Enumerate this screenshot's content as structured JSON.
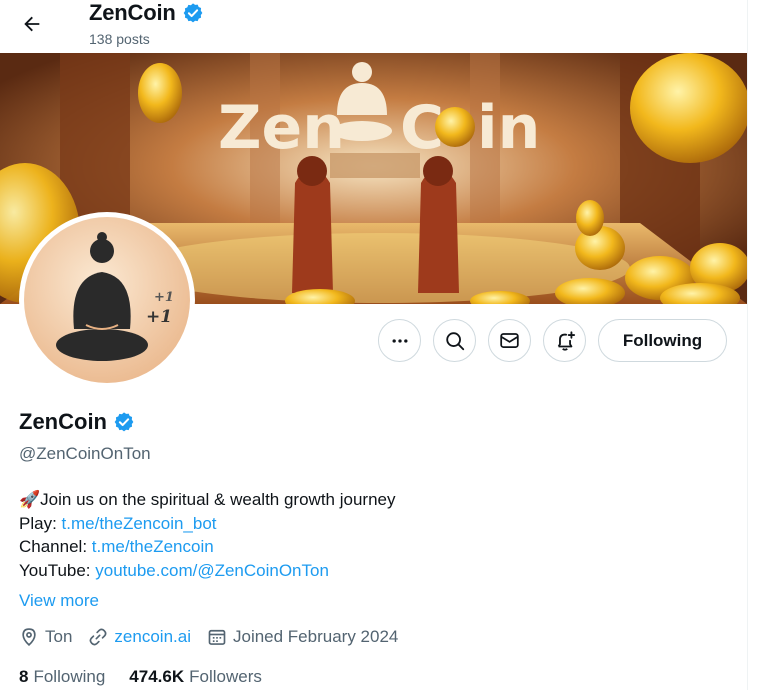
{
  "header": {
    "back_label": "Back",
    "name": "ZenCoin",
    "posts_count": "138 posts"
  },
  "banner": {
    "logo_text_left": "Zen",
    "logo_text_right": "C",
    "logo_text_end": "in"
  },
  "avatar": {
    "badge_1": "+1",
    "badge_2": "+1"
  },
  "actions": {
    "more_icon": "more-icon",
    "search_icon": "search-icon",
    "message_icon": "mail-icon",
    "notify_icon": "bell-plus-icon",
    "follow_label": "Following"
  },
  "profile": {
    "name": "ZenCoin",
    "handle": "@ZenCoinOnTon",
    "bio_line1": "🚀Join us on the spiritual & wealth growth journey",
    "play_label": "Play: ",
    "play_link": "t.me/theZencoin_bot",
    "channel_label": "Channel: ",
    "channel_link": "t.me/theZencoin",
    "youtube_label": "YouTube: ",
    "youtube_link": "youtube.com/@ZenCoinOnTon",
    "view_more": "View more",
    "location": "Ton",
    "website": "zencoin.ai",
    "joined": "Joined February 2024"
  },
  "stats": {
    "following_count": "8",
    "following_label": "Following",
    "followers_count": "474.6K",
    "followers_label": "Followers"
  },
  "colors": {
    "accent": "#1d9bf0",
    "text": "#0f1419",
    "muted": "#536471",
    "border": "#cfd9de"
  }
}
